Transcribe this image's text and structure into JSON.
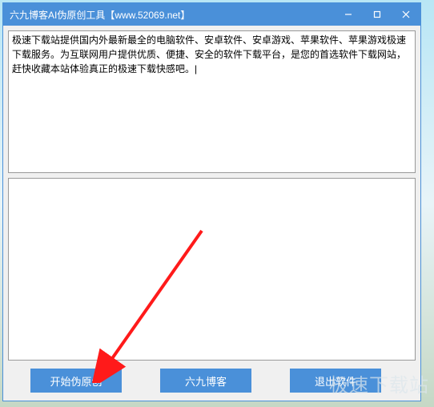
{
  "window": {
    "title": "六九博客AI伪原创工具【www.52069.net】"
  },
  "input": {
    "content": "极速下载站提供国内外最新最全的电脑软件、安卓软件、安卓游戏、苹果软件、苹果游戏极速下载服务。为互联网用户提供优质、便捷、安全的软件下载平台，是您的首选软件下载网站，赶快收藏本站体验真正的极速下载快感吧。|"
  },
  "output": {
    "content": ""
  },
  "buttons": {
    "start": "开始伪原创",
    "blog": "六九博客",
    "exit": "退出软件"
  },
  "watermark": "极速下载站"
}
